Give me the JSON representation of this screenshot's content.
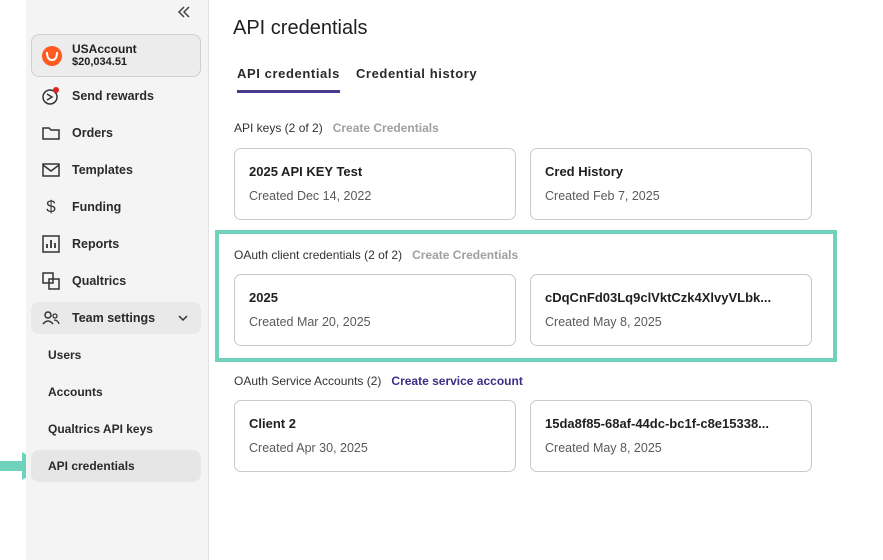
{
  "sidebar": {
    "account": {
      "name": "USAccount",
      "balance": "$20,034.51"
    },
    "nav": [
      {
        "label": "Send rewards",
        "icon": "send-rewards-icon"
      },
      {
        "label": "Orders",
        "icon": "folder-icon"
      },
      {
        "label": "Templates",
        "icon": "envelope-icon"
      },
      {
        "label": "Funding",
        "icon": "dollar-icon"
      },
      {
        "label": "Reports",
        "icon": "bar-chart-icon"
      },
      {
        "label": "Qualtrics",
        "icon": "qualtrics-icon"
      },
      {
        "label": "Team settings",
        "icon": "team-icon"
      }
    ],
    "sub_items": [
      "Users",
      "Accounts",
      "Qualtrics API keys",
      "API credentials"
    ]
  },
  "main": {
    "title": "API credentials",
    "tabs": [
      {
        "label": "API credentials",
        "active": true
      },
      {
        "label": "Credential history",
        "active": false
      }
    ],
    "sections": [
      {
        "heading": "API keys (2 of 2)",
        "action": "Create Credentials",
        "cards": [
          {
            "name": "2025 API KEY Test",
            "created": "Created Dec 14, 2022"
          },
          {
            "name": "Cred History",
            "created": "Created Feb 7, 2025"
          }
        ]
      },
      {
        "heading": "OAuth client credentials (2 of 2)",
        "action": "Create Credentials",
        "cards": [
          {
            "name": "2025",
            "created": "Created Mar 20, 2025"
          },
          {
            "name": "cDqCnFd03Lq9clVktCzk4XlvyVLbk...",
            "created": "Created May 8, 2025"
          }
        ]
      },
      {
        "heading": "OAuth Service Accounts (2)",
        "action": "Create service account",
        "cards": [
          {
            "name": "Client 2",
            "created": "Created Apr 30, 2025"
          },
          {
            "name": "15da8f85-68af-44dc-bc1f-c8e15338...",
            "created": "Created May 8, 2025"
          }
        ]
      }
    ]
  },
  "colors": {
    "accent": "#4a3a8c",
    "highlight": "#6ed2bd",
    "brand": "#ff5a1f",
    "disabled_action": "#a0a0a0"
  }
}
